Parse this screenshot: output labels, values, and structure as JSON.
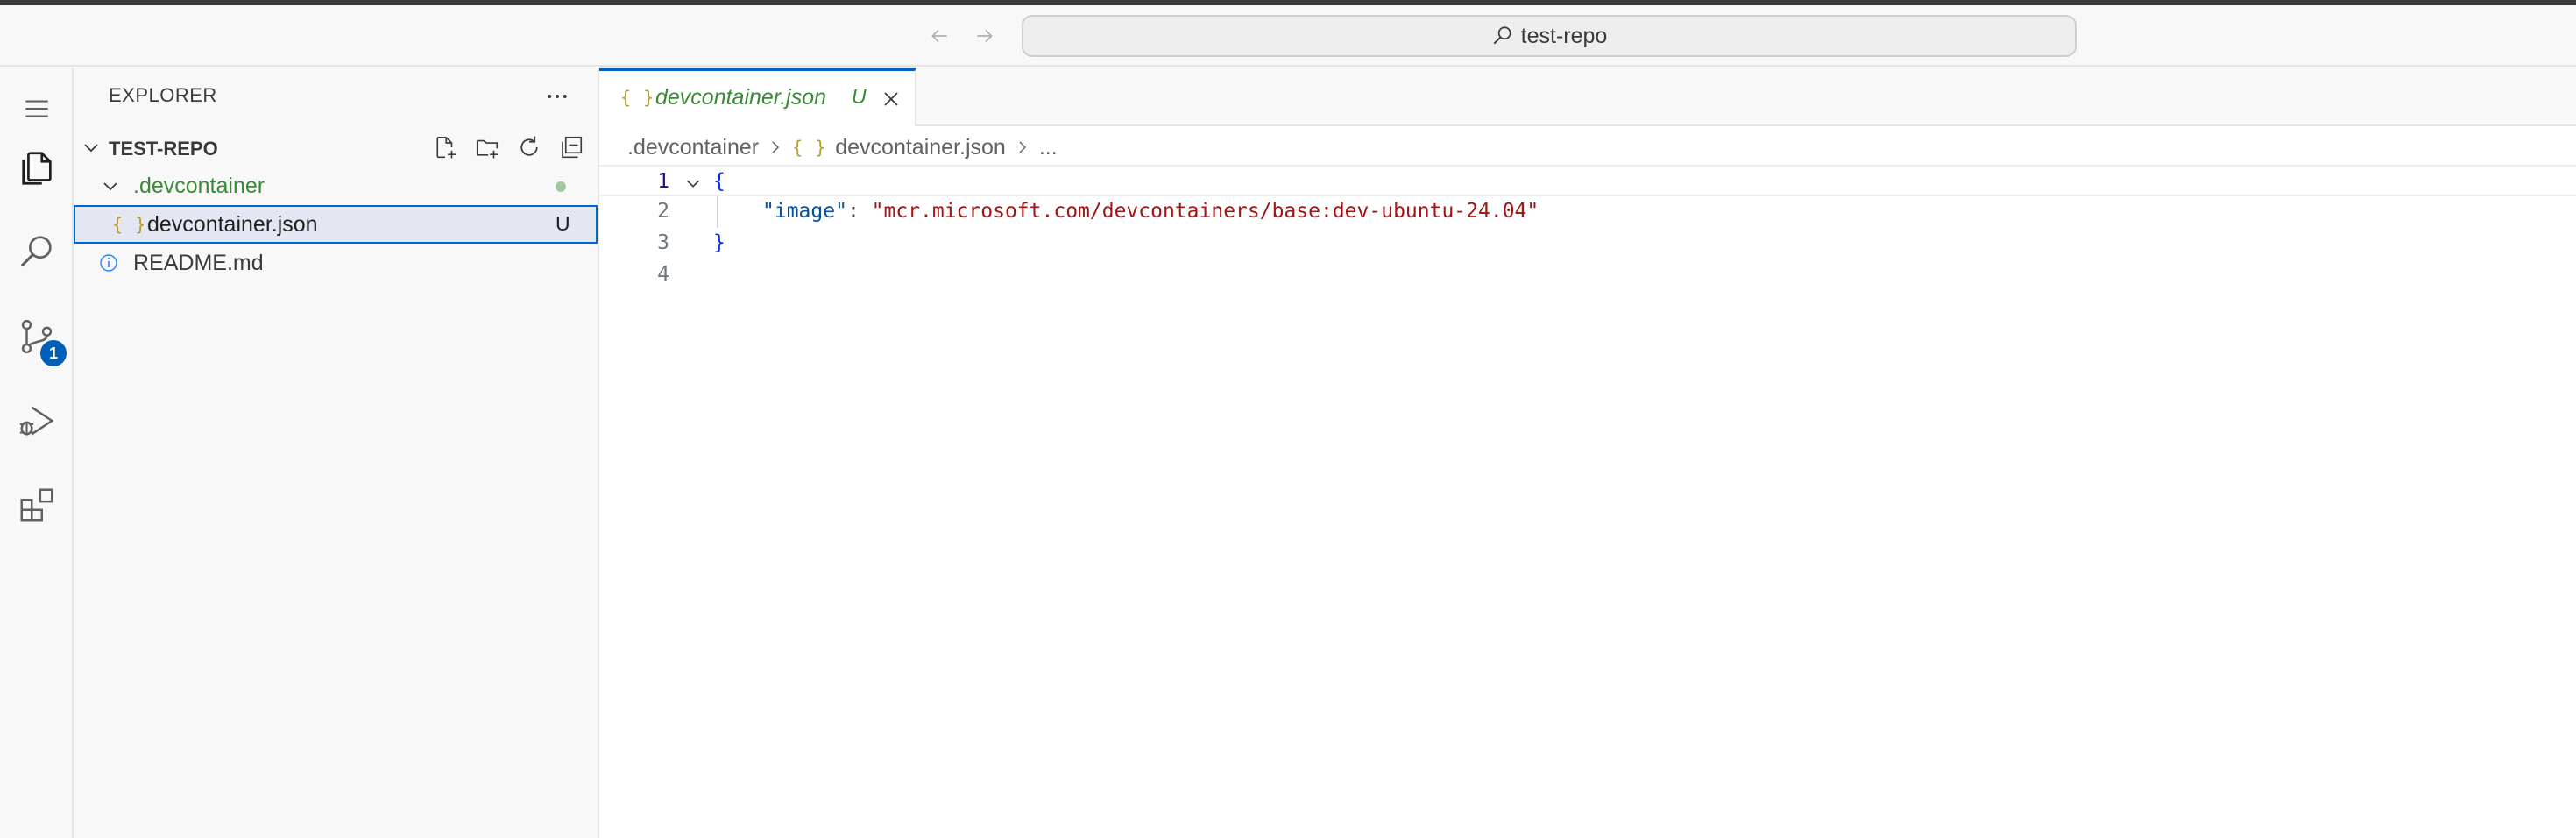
{
  "titlebar": {
    "search_text": "test-repo"
  },
  "activity_bar": {
    "scm_badge": "1"
  },
  "explorer": {
    "title": "EXPLORER",
    "section_title": "TEST-REPO",
    "folder": {
      "name": ".devcontainer"
    },
    "files": [
      {
        "name": "devcontainer.json",
        "status": "U"
      },
      {
        "name": "README.md"
      }
    ]
  },
  "editor": {
    "tab": {
      "label": "devcontainer.json",
      "status": "U"
    },
    "breadcrumb": {
      "folder": ".devcontainer",
      "file": "devcontainer.json",
      "more": "..."
    },
    "lines": [
      {
        "number": "1",
        "open_brace": "{"
      },
      {
        "number": "2",
        "key": "\"image\"",
        "colon": ": ",
        "value": "\"mcr.microsoft.com/devcontainers/base:dev-ubuntu-24.04\""
      },
      {
        "number": "3",
        "close_brace": "}"
      },
      {
        "number": "4"
      }
    ],
    "json_icon_glyph": "{ }"
  },
  "colors": {
    "accent": "#005fb8",
    "untracked_green": "#388a34",
    "json_icon": "#b59c2c",
    "string": "#a31515",
    "key": "#0451a5"
  }
}
